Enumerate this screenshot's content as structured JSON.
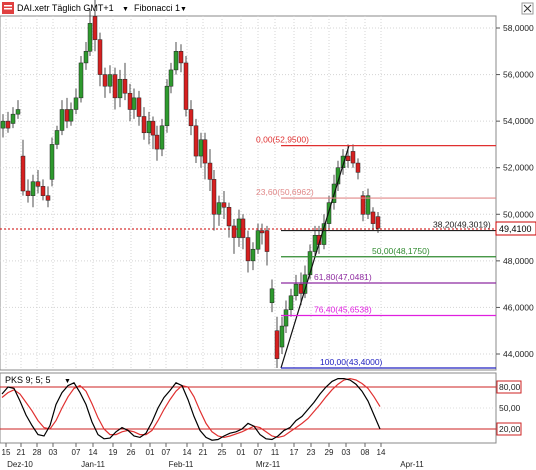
{
  "header": {
    "instrument": "DAI.xetr Täglich GMT+1",
    "dropdown_arrow": "▼",
    "tool_name": "Fibonacci 1",
    "icon": "chart-logo-icon",
    "close_icon": "close-icon"
  },
  "price_axis": {
    "labels": [
      "58,0000",
      "56,0000",
      "54,0000",
      "52,0000",
      "50,0000",
      "48,0000",
      "46,0000",
      "44,0000"
    ],
    "current_price": "49,4100",
    "current_price_color": "#cc0000"
  },
  "fibonacci": {
    "levels": [
      {
        "label": "0,00(52,9500)",
        "color": "#e03030"
      },
      {
        "label": "23,60(50,6962)",
        "color": "#e08888"
      },
      {
        "label": "38,20(49,3019)",
        "color": "#222222"
      },
      {
        "label": "50,00(48,1750)",
        "color": "#2f8a2f"
      },
      {
        "label": "61,80(47,0481)",
        "color": "#8e2aa0"
      },
      {
        "label": "76,40(45,6538)",
        "color": "#e020e0"
      },
      {
        "label": "100,00(43,4000)",
        "color": "#2020c0"
      }
    ]
  },
  "indicator": {
    "title": "PKS 9; 5; 5",
    "dropdown_arrow": "▼",
    "levels": [
      "80,00",
      "50,00",
      "20,00"
    ],
    "band_color": "#cc2222",
    "line_colors": [
      "#000000",
      "#e03030"
    ]
  },
  "time_axis": {
    "day_labels": [
      "15",
      "21",
      "28",
      "03",
      "07",
      "14",
      "19",
      "26",
      "01",
      "07",
      "14",
      "21",
      "25",
      "01",
      "07",
      "11",
      "17",
      "23",
      "29",
      "03",
      "08",
      "14"
    ],
    "month_labels": [
      "Dez-10",
      "Jan-11",
      "Feb-11",
      "Mrz-11",
      "Apr-11"
    ]
  },
  "colors": {
    "bull": "#2e9a2e",
    "bear": "#d62020",
    "grid": "#d4d4d4"
  }
}
